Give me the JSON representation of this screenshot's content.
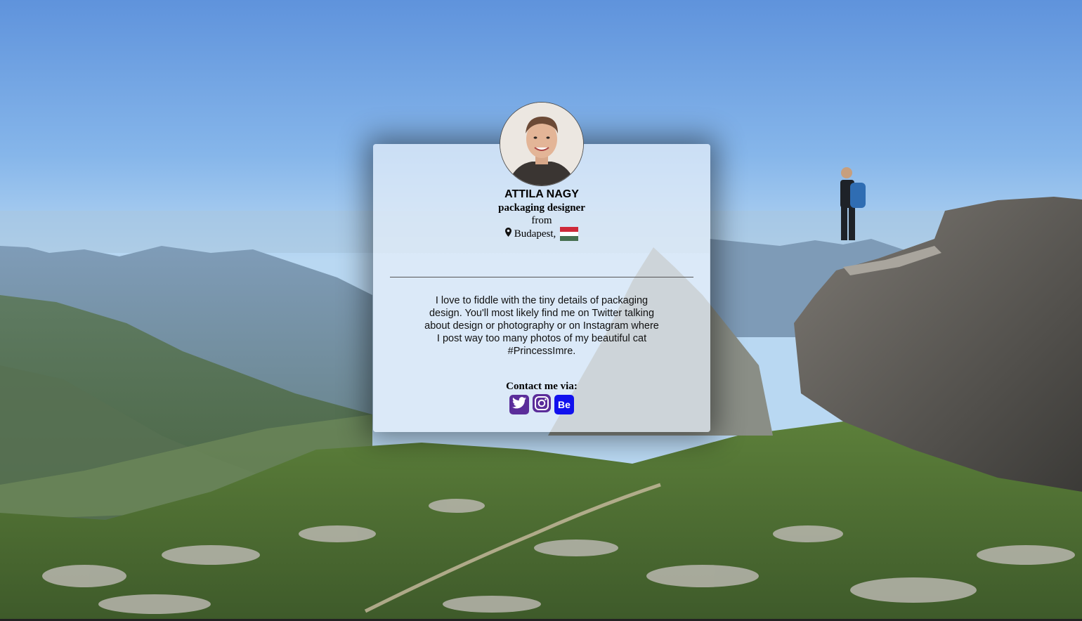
{
  "profile": {
    "name": "ATTILA NAGY",
    "role": "packaging designer",
    "from_label": "from",
    "location": "Budapest,",
    "flag_colors": [
      "#ce2939",
      "#ffffff",
      "#477050"
    ],
    "bio": "I love to fiddle with the tiny details of packaging design. You'll most likely find me on Twitter talking about design or photography or on Instagram where I post way too many photos of my beautiful cat #PrincessImre."
  },
  "contact": {
    "label": "Contact me via:",
    "links": [
      {
        "name": "twitter",
        "icon": "twitter-icon",
        "color": "#5b2d9a"
      },
      {
        "name": "instagram",
        "icon": "instagram-icon",
        "color": "#5b2d9a"
      },
      {
        "name": "behance",
        "icon": "behance-icon",
        "text": "Be",
        "color": "#1111ee"
      }
    ]
  },
  "theme": {
    "card_bg": "rgba(232,240,250,0.72)",
    "sky_top": "#5f93dc",
    "sky_bottom": "#a9d0f2"
  }
}
